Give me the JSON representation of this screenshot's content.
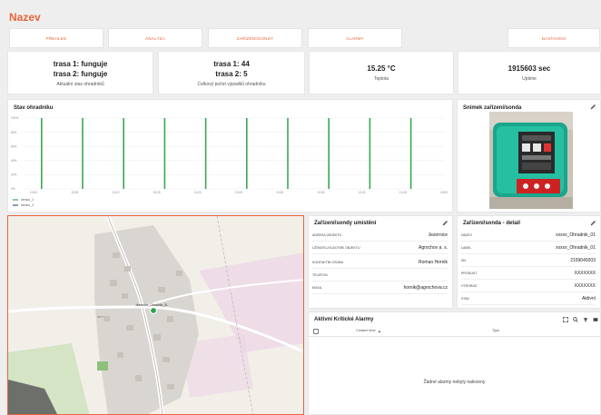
{
  "app": {
    "title": "Nazev"
  },
  "nav": [
    {
      "label": "Přehled"
    },
    {
      "label": "Analýza"
    },
    {
      "label": "Zařízení/sondy"
    },
    {
      "label": "Alarmy"
    },
    {
      "label": "Nastavení"
    }
  ],
  "stats": [
    {
      "lines": [
        "trasa 1: funguje",
        "trasa 2: funguje"
      ],
      "caption": "Aktuální stav ohradníků"
    },
    {
      "lines": [
        "trasa 1: 44",
        "trasa 2: 5"
      ],
      "caption": "Celkový počet výpadků ohradníku"
    },
    {
      "lines": [
        "15.25 °C"
      ],
      "caption": "Teplota"
    },
    {
      "lines": [
        "1915603 sec"
      ],
      "caption": "Uptime"
    }
  ],
  "chart_card": {
    "title": "Stav ohradníku"
  },
  "chart_data": {
    "type": "bar",
    "title": "Stav ohradníku",
    "y_ticks": [
      "100%",
      "80%",
      "60%",
      "40%",
      "20%",
      "0%"
    ],
    "ylim": [
      0,
      100
    ],
    "x_ticks": [
      "13:00",
      "13:05",
      "13:10",
      "13:15",
      "13:20",
      "13:25",
      "13:30",
      "13:35",
      "13:40",
      "13:45",
      "13:50"
    ],
    "series": [
      {
        "name": "sensor_1",
        "color": "#3aa654",
        "values": [
          100,
          100,
          100,
          100,
          100,
          100,
          100,
          100,
          100,
          100,
          0
        ]
      },
      {
        "name": "sensor_2",
        "color": "#2b5f8a",
        "values": []
      }
    ]
  },
  "photo_card": {
    "title": "Snímek zařízení/sonda"
  },
  "location_card": {
    "title": "Zařízení/sondy umístění",
    "rows": [
      {
        "key": "Adresa objektu",
        "value": "Jezernice"
      },
      {
        "key": "Uživatel/vlastník objektu",
        "value": "Agrochov a. s."
      },
      {
        "key": "Kontaktní osoba",
        "value": "Roman Hornik"
      },
      {
        "key": "Telefon",
        "value": ""
      },
      {
        "key": "Email",
        "value": "hornik@agrochova.cz"
      }
    ]
  },
  "detail_card": {
    "title": "Zařízení/sonda - detail",
    "rows": [
      {
        "key": "Název",
        "value": "xxxxx_Ohradnik_01"
      },
      {
        "key": "Label",
        "value": "xxxxx_Ohradnik_01"
      },
      {
        "key": "SN",
        "value": "2159049203"
      },
      {
        "key": "Produkt",
        "value": "XXXXXXX"
      },
      {
        "key": "Výrobce",
        "value": "XXXXXXX"
      },
      {
        "key": "Stav",
        "value": "Aktivní"
      }
    ]
  },
  "alarms_card": {
    "title": "Aktivní Kritické Alarmy",
    "col_created": "Created time",
    "col_type": "Type",
    "empty": "Žádné alarmy nebyly nalezeny"
  },
  "map": {
    "marker_label": "Jezernice_Ohradnik_01",
    "road_label": "4377"
  }
}
